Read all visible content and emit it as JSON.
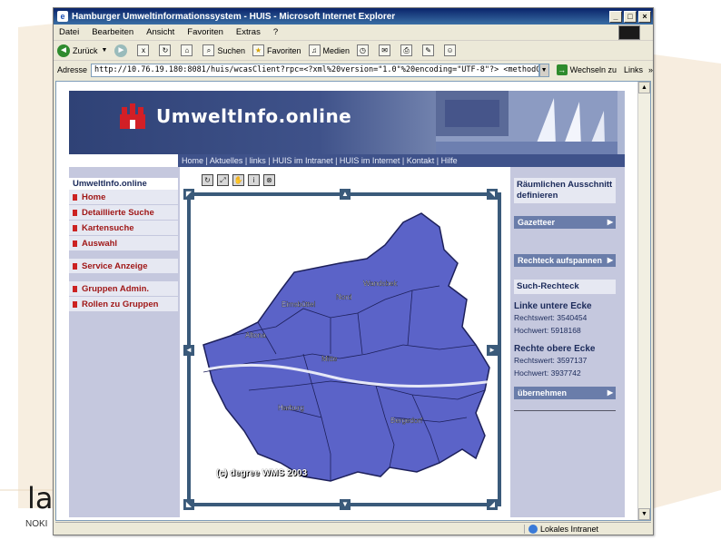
{
  "window": {
    "title": "Hamburger Umweltinformationssystem - HUIS - Microsoft Internet Explorer",
    "controls": [
      "_",
      "□",
      "×"
    ]
  },
  "menubar": [
    "Datei",
    "Bearbeiten",
    "Ansicht",
    "Favoriten",
    "Extras",
    "?"
  ],
  "toolbar": {
    "back": "Zurück",
    "search": "Suchen",
    "favorites": "Favoriten",
    "media": "Medien"
  },
  "addressbar": {
    "label": "Adresse",
    "url": "http://10.76.19.180:8081/huis/wcasClient?rpc=<?xml%20version=\"1.0\"%20encoding=\"UTF-8\"?> <methodCall> <methodName",
    "go": "Wechseln zu",
    "links": "Links"
  },
  "statusbar": {
    "zone": "Lokales Intranet"
  },
  "page": {
    "brand": "UmweltInfo.online",
    "topnav": "Home | Aktuelles | links | HUIS im Intranet | HUIS im Internet | Kontakt | Hilfe",
    "leftnav": {
      "header": "UmweltInfo.online",
      "group1": [
        "Home",
        "Detaillierte Suche",
        "Kartensuche",
        "Auswahl"
      ],
      "group2": [
        "Service Anzeige"
      ],
      "group3": [
        "Gruppen Admin.",
        "Rollen zu Gruppen"
      ]
    },
    "map": {
      "copyright": "(c) degree WMS 2003",
      "labels": [
        "Wandsbek",
        "Eimsbüttel",
        "Nord",
        "Altona",
        "Mitte",
        "Harburg",
        "Bergedorf"
      ]
    },
    "rightpanel": {
      "define_area": "Räumlichen Ausschnitt definieren",
      "gazetteer": "Gazetteer",
      "span_rect": "Rechteck aufspannen",
      "search_rect": "Such-Rechteck",
      "lower_left": "Linke untere Ecke",
      "ll_right": "Rechtswert: 3540454",
      "ll_high": "Hochwert: 5918168",
      "upper_right": "Rechte obere Ecke",
      "ur_right": "Rechtswert: 3597137",
      "ur_high": "Hochwert: 3937742",
      "apply": "übernehmen"
    }
  },
  "slide": {
    "logo": "la",
    "footer": "NOKI"
  },
  "colors": {
    "banner": "#2f4276",
    "map_fill": "#5b63c8",
    "frame": "#3a5a7a",
    "nav_red": "#a01818"
  }
}
